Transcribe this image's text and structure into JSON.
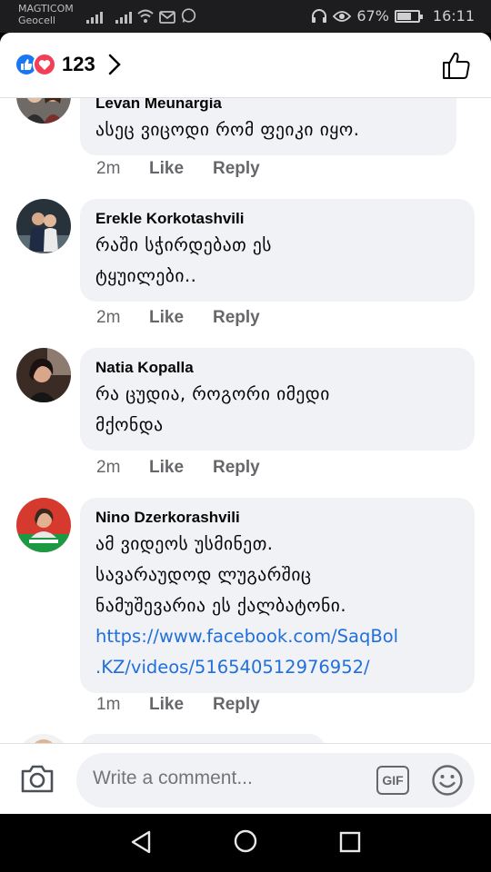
{
  "status_bar": {
    "carrier": "MAGTICOM",
    "carrier2": "Geocell",
    "battery": "67%",
    "battery_level": 0.67,
    "time": "16:11",
    "icons": [
      "signal-icon",
      "signal-icon",
      "wifi-icon",
      "gmail-icon",
      "whatsapp-icon",
      "headset-icon",
      "eye-icon",
      "battery-icon"
    ]
  },
  "header": {
    "reaction_count": "123",
    "reactions": [
      "like",
      "love"
    ]
  },
  "comments": [
    {
      "author": "Levan Meunargia",
      "lines": [
        "ასეც ვიცოდი რომ ფეიკი იყო."
      ],
      "time": "2m",
      "like_label": "Like",
      "reply_label": "Reply"
    },
    {
      "author": "Erekle Korkotashvili",
      "lines": [
        "რაში სჭირდებათ ეს",
        "ტყუილები.."
      ],
      "time": "2m",
      "like_label": "Like",
      "reply_label": "Reply"
    },
    {
      "author": "Natia Kopalla",
      "lines": [
        "რა ცუდია, როგორი იმედი",
        "მქონდა"
      ],
      "time": "2m",
      "like_label": "Like",
      "reply_label": "Reply"
    },
    {
      "author": "Nino Dzerkorashvili",
      "lines": [
        "ამ ვიდეოს უსმინეთ.",
        "სავარაუდოდ ლუგარშიც",
        "ნამუშევარია ეს ქალბატონი."
      ],
      "link_lines": [
        "https://www.facebook.com/SaqBol",
        ".KZ/videos/516540512976952/"
      ],
      "time": "1m",
      "like_label": "Like",
      "reply_label": "Reply"
    }
  ],
  "composer": {
    "placeholder": "Write a comment...",
    "gif_label": "GIF"
  },
  "colors": {
    "like_blue": "#1877f2",
    "love_red": "#f33e58",
    "bubble_gray": "#f0f2f5",
    "link_blue": "#216fdb",
    "meta_gray": "#65676b"
  }
}
